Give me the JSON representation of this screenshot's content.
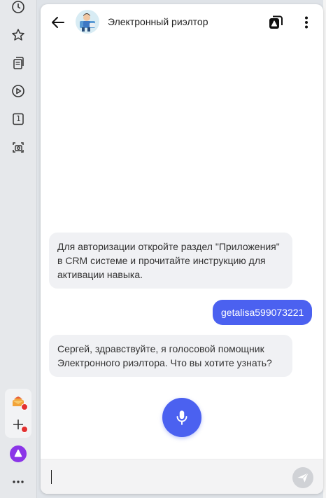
{
  "header": {
    "title": "Электронный риэлтор"
  },
  "messages": [
    {
      "from": "bot",
      "text": "Для авторизации откройте раздел \"Приложения\" в CRM системе и прочитайте инструкцию для активации навыка."
    },
    {
      "from": "user",
      "text": "getalisa599073221"
    },
    {
      "from": "bot",
      "text": "Сергей, здравствуйте, я голосовой помощник Электронного риэлтора. Что вы хотите узнать?"
    }
  ],
  "sidebar": {
    "icons": [
      "history-icon",
      "star-icon",
      "collections-icon",
      "play-icon",
      "tab-counter-icon",
      "screenshot-icon",
      "mail-icon",
      "add-icon",
      "alice-icon",
      "more-icon"
    ],
    "tab_count": "1"
  },
  "colors": {
    "accent": "#4b61f0",
    "bot_bubble": "#f0f1f4",
    "notification": "#e23030"
  }
}
